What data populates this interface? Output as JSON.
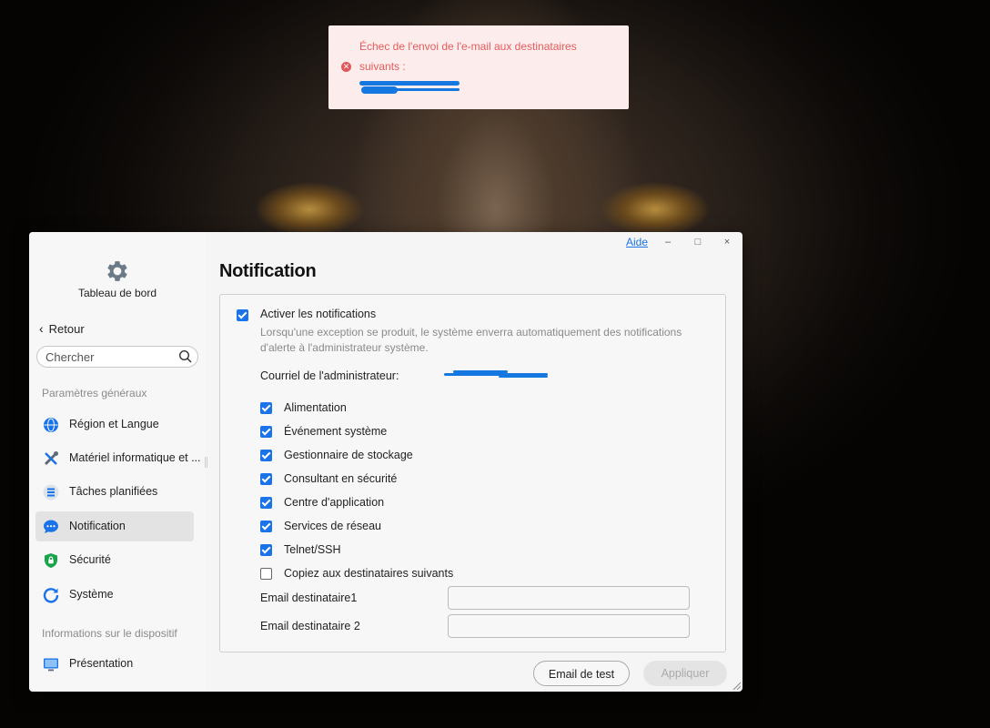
{
  "toast": {
    "message": "Échec de l'envoi de l'e-mail aux destinataires suivants :",
    "icon": "error-icon",
    "color": "#e55b5b"
  },
  "window": {
    "help_label": "Aide",
    "minimize": "–",
    "maximize": "□",
    "close": "×"
  },
  "sidebar": {
    "dashboard_label": "Tableau de bord",
    "back_label": "Retour",
    "search_placeholder": "Chercher",
    "section_general": "Paramètres généraux",
    "section_device": "Informations sur le dispositif",
    "items": [
      {
        "label": "Région et Langue",
        "icon": "globe-icon"
      },
      {
        "label": "Matériel informatique et ...",
        "icon": "tools-icon"
      },
      {
        "label": "Tâches planifiées",
        "icon": "tasks-icon"
      },
      {
        "label": "Notification",
        "icon": "chat-bubble-icon",
        "active": true
      },
      {
        "label": "Sécurité",
        "icon": "shield-icon"
      },
      {
        "label": "Système",
        "icon": "refresh-icon"
      },
      {
        "label": "Présentation",
        "icon": "monitor-icon"
      }
    ]
  },
  "main": {
    "title": "Notification",
    "enable_label": "Activer les notifications",
    "enable_checked": true,
    "description": "Lorsqu'une exception se produit, le système enverra automatiquement des notifications d'alerte à l'administrateur système.",
    "admin_email_label": "Courriel de l'administrateur:",
    "categories": [
      {
        "label": "Alimentation",
        "checked": true
      },
      {
        "label": "Événement système",
        "checked": true
      },
      {
        "label": "Gestionnaire de stockage",
        "checked": true
      },
      {
        "label": "Consultant en sécurité",
        "checked": true
      },
      {
        "label": "Centre d'application",
        "checked": true
      },
      {
        "label": "Services de réseau",
        "checked": true
      },
      {
        "label": "Telnet/SSH",
        "checked": true
      }
    ],
    "copy_label": "Copiez aux destinataires suivants",
    "copy_checked": false,
    "recipient1_label": "Email destinataire1",
    "recipient2_label": "Email destinataire 2",
    "recipient1_value": "",
    "recipient2_value": "",
    "test_button": "Email de test",
    "apply_button": "Appliquer"
  },
  "colors": {
    "accent": "#1a73e8",
    "error": "#e55b5b"
  }
}
